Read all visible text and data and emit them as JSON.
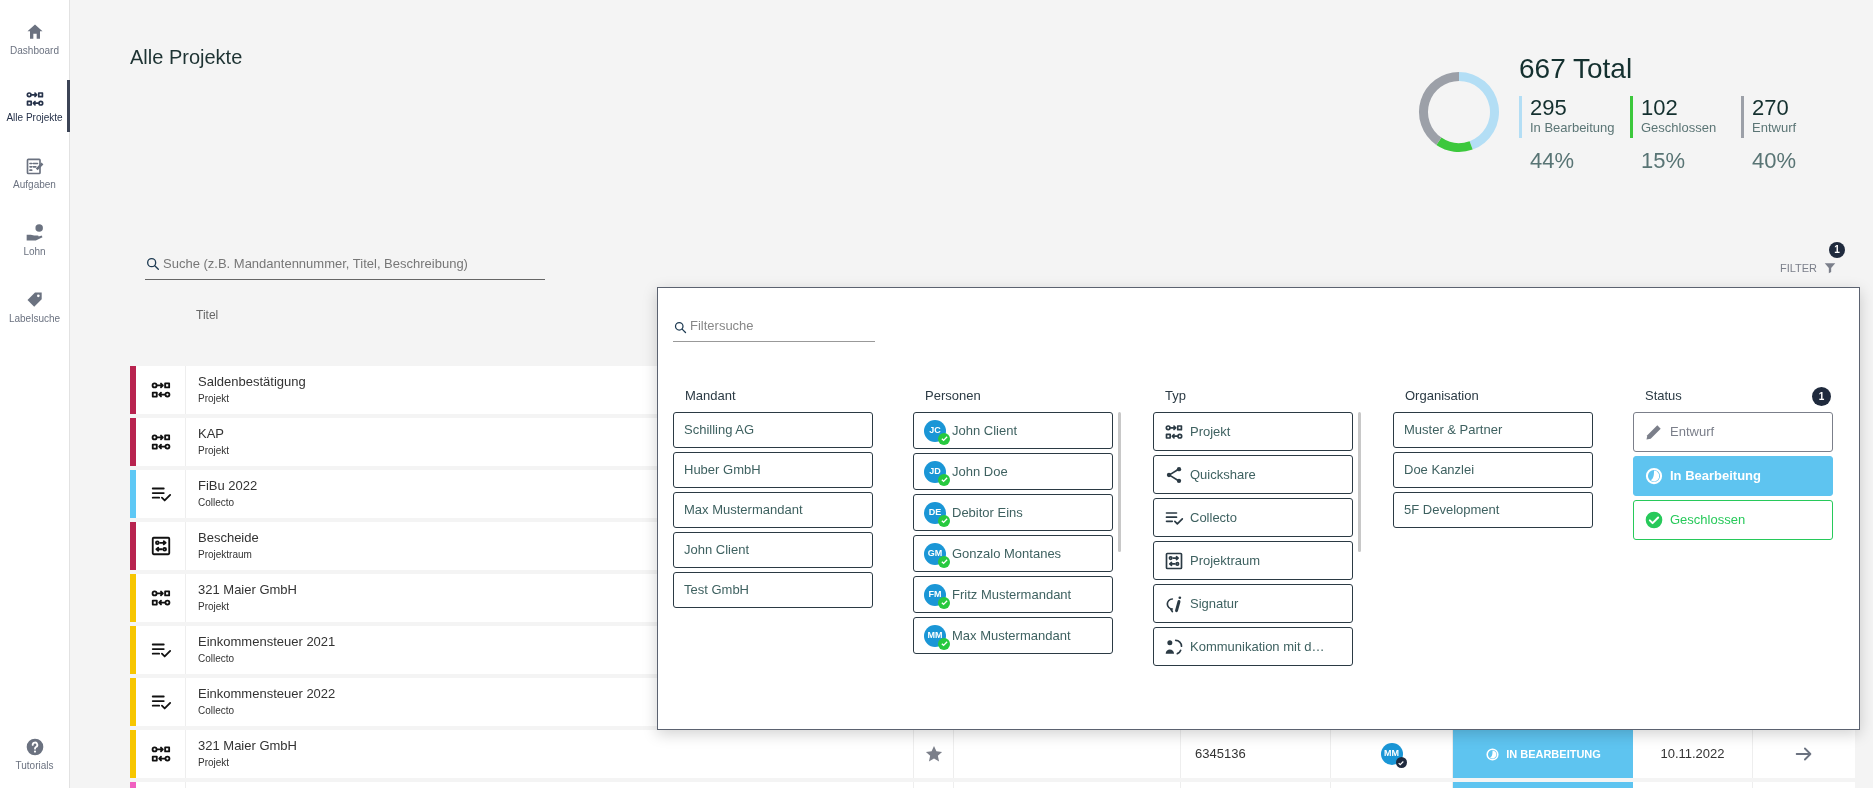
{
  "sidebar": {
    "items": [
      {
        "label": "Dashboard",
        "selected": false
      },
      {
        "label": "Alle Projekte",
        "selected": true
      },
      {
        "label": "Aufgaben",
        "selected": false
      },
      {
        "label": "Lohn",
        "selected": false
      },
      {
        "label": "Labelsuche",
        "selected": false
      }
    ],
    "footer_item": {
      "label": "Tutorials",
      "selected": false
    }
  },
  "page_title": "Alle Projekte",
  "summary": {
    "total": "667 Total",
    "stats": [
      {
        "value": "295",
        "percent": "44%",
        "color": "#b3def5"
      },
      {
        "value": "102",
        "percent": "15%",
        "color": "#3cc83c"
      },
      {
        "value": "270",
        "percent": "40%",
        "color": "#9ca0a8"
      }
    ],
    "chart_data": {
      "type": "donut",
      "categories": [
        "In Bearbeitung",
        "Geschlossen",
        "Entwurf"
      ],
      "values": [
        44,
        15,
        40
      ]
    }
  },
  "search": {
    "placeholder": "Suche (z.B. Mandantennummer, Titel, Beschreibung)"
  },
  "filter_button": {
    "label": "FILTER",
    "badge": "1"
  },
  "table": {
    "columns": [
      "Titel"
    ],
    "rows": [
      {
        "title": "Saldenbestätigung",
        "type": "Projekt",
        "kind": "projekt",
        "color": "#b8234f"
      },
      {
        "title": "KAP",
        "type": "Projekt",
        "kind": "projekt",
        "color": "#b8234f"
      },
      {
        "title": "FiBu 2022",
        "type": "Collecto",
        "kind": "collecto",
        "color": "#5ec8f5"
      },
      {
        "title": "Bescheide",
        "type": "Projektraum",
        "kind": "projektraum",
        "color": "#b8234f"
      },
      {
        "title": "321 Maier GmbH",
        "type": "Projekt",
        "kind": "projekt",
        "color": "#f7c600"
      },
      {
        "title": "Einkommensteuer 2021",
        "type": "Collecto",
        "kind": "collecto",
        "color": "#f7c600"
      },
      {
        "title": "Einkommensteuer 2022",
        "type": "Collecto",
        "kind": "collecto",
        "color": "#f7c600"
      },
      {
        "title": "321 Maier GmbH",
        "type": "Projekt",
        "kind": "projekt",
        "color": "#f7c600",
        "number": "6345136",
        "avatar": "MM",
        "status": {
          "label": "IN BEARBEITUNG",
          "kind": "in_bearbeitung"
        },
        "date": "10.11.2022"
      },
      {
        "color": "#f060c0",
        "status": {
          "kind": "in_bearbeitung"
        }
      }
    ]
  },
  "filter_panel": {
    "search": {
      "placeholder": "Filtersuche"
    },
    "columns": [
      {
        "title": "Mandant",
        "kind": "plain",
        "items": [
          {
            "label": "Schilling AG"
          },
          {
            "label": "Huber GmbH"
          },
          {
            "label": "Max Mustermandant"
          },
          {
            "label": "John Client"
          },
          {
            "label": "Test GmbH"
          }
        ]
      },
      {
        "title": "Personen",
        "kind": "person",
        "items": [
          {
            "label": "John Client",
            "initials": "JC",
            "verified": true
          },
          {
            "label": "John Doe",
            "initials": "JD",
            "verified": true
          },
          {
            "label": "Debitor Eins",
            "initials": "DE",
            "verified": true
          },
          {
            "label": "Gonzalo Montanes",
            "initials": "GM",
            "verified": true
          },
          {
            "label": "Fritz Mustermandant",
            "initials": "FM",
            "verified": true
          },
          {
            "label": "Max Mustermandant",
            "initials": "MM",
            "verified": true
          }
        ]
      },
      {
        "title": "Typ",
        "kind": "type",
        "items": [
          {
            "label": "Projekt",
            "kind": "projekt"
          },
          {
            "label": "Quickshare",
            "kind": "share"
          },
          {
            "label": "Collecto",
            "kind": "collecto"
          },
          {
            "label": "Projektraum",
            "kind": "projektraum"
          },
          {
            "label": "Signatur",
            "kind": "signatur"
          },
          {
            "label": "Kommunikation mit d…",
            "kind": "kommunikation"
          }
        ]
      },
      {
        "title": "Organisation",
        "kind": "plain",
        "items": [
          {
            "label": "Muster & Partner"
          },
          {
            "label": "Doe Kanzlei"
          },
          {
            "label": "5F Development"
          }
        ]
      },
      {
        "title": "Status",
        "kind": "status",
        "badge": "1",
        "items": [
          {
            "label": "Entwurf",
            "kind": "entwurf",
            "selected": false
          },
          {
            "label": "In Bearbeitung",
            "kind": "in_bearbeitung",
            "selected": true
          },
          {
            "label": "Geschlossen",
            "kind": "geschlossen",
            "selected": false
          }
        ]
      }
    ]
  }
}
